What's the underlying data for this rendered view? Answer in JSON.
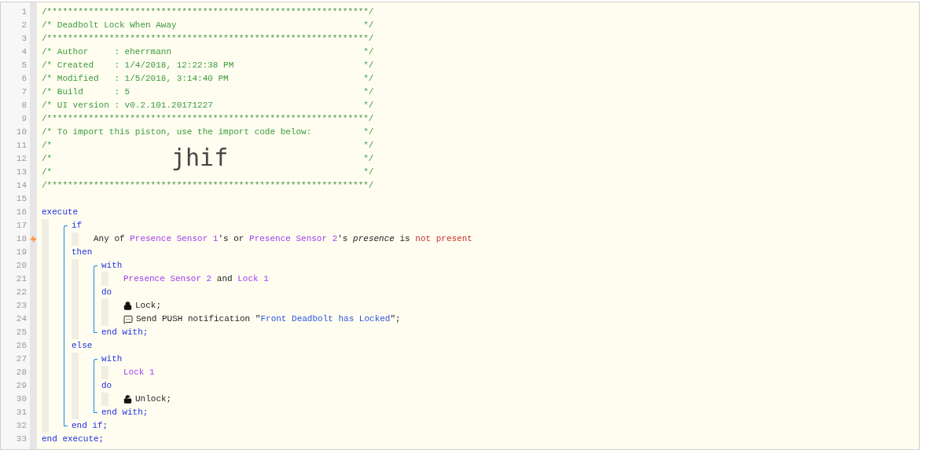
{
  "header": [
    {
      "kind": "rule",
      "number": "1",
      "text": "/**************************************************************/"
    },
    {
      "kind": "comment",
      "number": "2",
      "text": "/* Deadbolt Lock When Away",
      "end": "*/"
    },
    {
      "kind": "rule",
      "number": "3",
      "text": "/**************************************************************/"
    },
    {
      "kind": "comment",
      "number": "4",
      "text": "/* Author     : eherrmann",
      "end": "*/"
    },
    {
      "kind": "comment",
      "number": "5",
      "text": "/* Created    : 1/4/2018, 12:22:38 PM",
      "end": "*/"
    },
    {
      "kind": "comment",
      "number": "6",
      "text": "/* Modified   : 1/5/2018, 3:14:40 PM",
      "end": "*/"
    },
    {
      "kind": "comment",
      "number": "7",
      "text": "/* Build      : 5",
      "end": "*/"
    },
    {
      "kind": "comment",
      "number": "8",
      "text": "/* UI version : v0.2.101.20171227",
      "end": "*/"
    },
    {
      "kind": "rule",
      "number": "9",
      "text": "/**************************************************************/"
    },
    {
      "kind": "comment",
      "number": "10",
      "text": "/* To import this piston, use the import code below:",
      "end": "*/"
    },
    {
      "kind": "import",
      "code": "jhif",
      "lines": [
        {
          "number": "11",
          "text": "/*",
          "end": "*/"
        },
        {
          "number": "12",
          "text": "/*",
          "end": "*/"
        },
        {
          "number": "13",
          "text": "/*",
          "end": "*/"
        }
      ]
    },
    {
      "kind": "rule",
      "number": "14",
      "text": "/**************************************************************/"
    },
    {
      "kind": "blank",
      "number": "15"
    }
  ],
  "code": [
    {
      "kind": "line",
      "number": "16",
      "tokens": [
        {
          "text": "execute",
          "kind": "keyword"
        }
      ]
    },
    {
      "kind": "body",
      "items": [
        {
          "kind": "group",
          "items": [
            {
              "kind": "line",
              "number": "17",
              "tokens": [
                {
                  "text": "if",
                  "kind": "keyword"
                }
              ]
            },
            {
              "kind": "body",
              "items": [
                {
                  "kind": "line",
                  "number": "18",
                  "trigger": true,
                  "tokens": [
                    {
                      "text": "Any of ",
                      "kind": "plain"
                    },
                    {
                      "text": "Presence Sensor 1",
                      "kind": "device"
                    },
                    {
                      "text": "'s or ",
                      "kind": "plain"
                    },
                    {
                      "text": "Presence Sensor 2",
                      "kind": "device"
                    },
                    {
                      "text": "'s ",
                      "kind": "plain"
                    },
                    {
                      "text": "presence",
                      "kind": "italic"
                    },
                    {
                      "text": " is ",
                      "kind": "plain"
                    },
                    {
                      "text": "not present",
                      "kind": "negative"
                    }
                  ]
                }
              ]
            },
            {
              "kind": "line",
              "number": "19",
              "tokens": [
                {
                  "text": "then",
                  "kind": "keyword"
                }
              ]
            },
            {
              "kind": "body",
              "items": [
                {
                  "kind": "group",
                  "items": [
                    {
                      "kind": "line",
                      "number": "20",
                      "tokens": [
                        {
                          "text": "with",
                          "kind": "keyword"
                        }
                      ]
                    },
                    {
                      "kind": "body",
                      "items": [
                        {
                          "kind": "line",
                          "number": "21",
                          "tokens": [
                            {
                              "text": "Presence Sensor 2",
                              "kind": "device"
                            },
                            {
                              "text": " and ",
                              "kind": "plain"
                            },
                            {
                              "text": "Lock 1",
                              "kind": "device"
                            }
                          ]
                        }
                      ]
                    },
                    {
                      "kind": "line",
                      "number": "22",
                      "tokens": [
                        {
                          "text": "do",
                          "kind": "keyword"
                        }
                      ]
                    },
                    {
                      "kind": "body",
                      "items": [
                        {
                          "kind": "lock",
                          "number": "23",
                          "tokens": [
                            {
                              "text": "Lock;",
                              "kind": "plain"
                            }
                          ]
                        },
                        {
                          "kind": "notify",
                          "number": "24",
                          "tokens": [
                            {
                              "text": "Send PUSH notification \"",
                              "kind": "plain"
                            },
                            {
                              "text": "Front Deadbolt has Locked",
                              "kind": "string"
                            },
                            {
                              "text": "\";",
                              "kind": "plain"
                            }
                          ]
                        }
                      ]
                    },
                    {
                      "kind": "line",
                      "number": "25",
                      "tokens": [
                        {
                          "text": "end with;",
                          "kind": "keyword"
                        }
                      ]
                    }
                  ]
                }
              ]
            },
            {
              "kind": "line",
              "number": "26",
              "tokens": [
                {
                  "text": "else",
                  "kind": "keyword"
                }
              ]
            },
            {
              "kind": "body",
              "items": [
                {
                  "kind": "group",
                  "items": [
                    {
                      "kind": "line",
                      "number": "27",
                      "tokens": [
                        {
                          "text": "with",
                          "kind": "keyword"
                        }
                      ]
                    },
                    {
                      "kind": "body",
                      "items": [
                        {
                          "kind": "line",
                          "number": "28",
                          "tokens": [
                            {
                              "text": "Lock 1",
                              "kind": "device"
                            }
                          ]
                        }
                      ]
                    },
                    {
                      "kind": "line",
                      "number": "29",
                      "tokens": [
                        {
                          "text": "do",
                          "kind": "keyword"
                        }
                      ]
                    },
                    {
                      "kind": "body",
                      "items": [
                        {
                          "kind": "unlock",
                          "number": "30",
                          "tokens": [
                            {
                              "text": "Unlock;",
                              "kind": "plain"
                            }
                          ]
                        }
                      ]
                    },
                    {
                      "kind": "line",
                      "number": "31",
                      "tokens": [
                        {
                          "text": "end with;",
                          "kind": "keyword"
                        }
                      ]
                    }
                  ]
                }
              ]
            },
            {
              "kind": "line",
              "number": "32",
              "tokens": [
                {
                  "text": "end if;",
                  "kind": "keyword"
                }
              ]
            }
          ]
        }
      ]
    },
    {
      "kind": "line",
      "number": "33",
      "tokens": [
        {
          "text": "end execute;",
          "kind": "keyword"
        }
      ]
    }
  ]
}
